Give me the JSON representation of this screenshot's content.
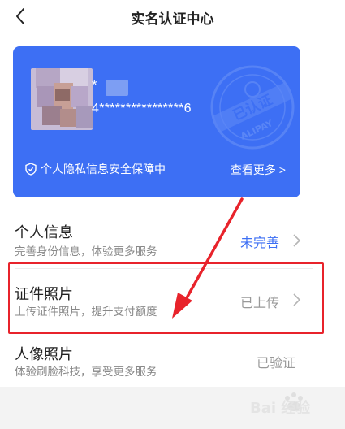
{
  "nav": {
    "title": "实名认证中心",
    "back_icon": "chevron-left-icon"
  },
  "card": {
    "masked_name": "*",
    "masked_id": "4****************6",
    "privacy_text": "个人隐私信息安全保障中",
    "view_more": "查看更多 >",
    "stamp_text": "已认证",
    "stamp_brand": "ALIPAY",
    "background_color": "#3D6FF4"
  },
  "rows": [
    {
      "title": "个人信息",
      "subtitle": "完善身份信息，体验更多服务",
      "status": "未完善",
      "status_color": "#3D6FF4",
      "has_chevron": true
    },
    {
      "title": "证件照片",
      "subtitle": "上传证件照片，提升支付额度",
      "status": "已上传",
      "status_color": "#999999",
      "has_chevron": true
    },
    {
      "title": "人像照片",
      "subtitle": "体验刷脸科技，享受更多服务",
      "status": "已验证",
      "status_color": "#999999",
      "has_chevron": false
    }
  ],
  "annotation": {
    "color": "#e8232b"
  },
  "watermark": {
    "text": "Bai 经验"
  }
}
